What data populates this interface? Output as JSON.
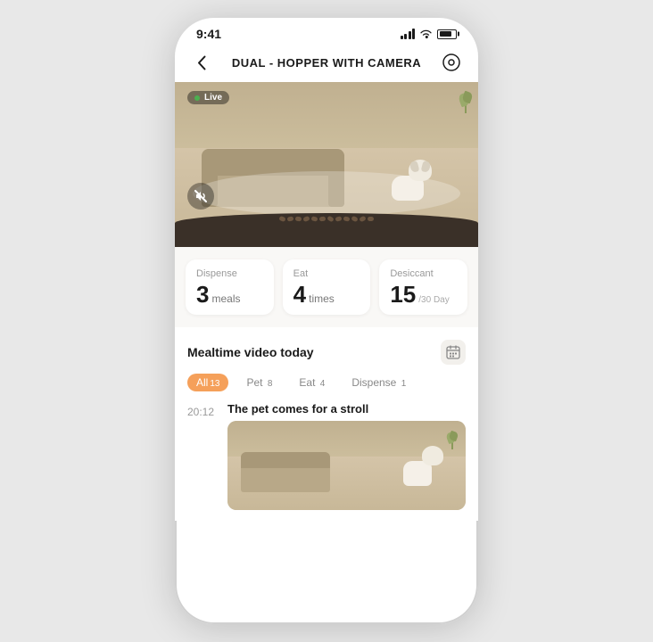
{
  "status_bar": {
    "time": "9:41"
  },
  "nav": {
    "title": "DUAL - HOPPER WITH CAMERA",
    "back_label": "‹",
    "settings_label": "⊙"
  },
  "camera": {
    "live_label": "Live"
  },
  "stats": [
    {
      "label": "Dispense",
      "value": "3",
      "unit": "meals",
      "unit_extra": ""
    },
    {
      "label": "Eat",
      "value": "4",
      "unit": "times",
      "unit_extra": ""
    },
    {
      "label": "Desiccant",
      "value": "15",
      "unit": "/30 Day",
      "unit_extra": ""
    }
  ],
  "mealtime_section": {
    "title": "Mealtime video today",
    "filters": [
      {
        "label": "All",
        "count": "13",
        "active": true
      },
      {
        "label": "Pet",
        "count": "8",
        "active": false
      },
      {
        "label": "Eat",
        "count": "4",
        "active": false
      },
      {
        "label": "Dispense",
        "count": "1",
        "active": false
      }
    ],
    "videos": [
      {
        "time": "20:12",
        "title": "The pet comes for a stroll"
      }
    ]
  }
}
